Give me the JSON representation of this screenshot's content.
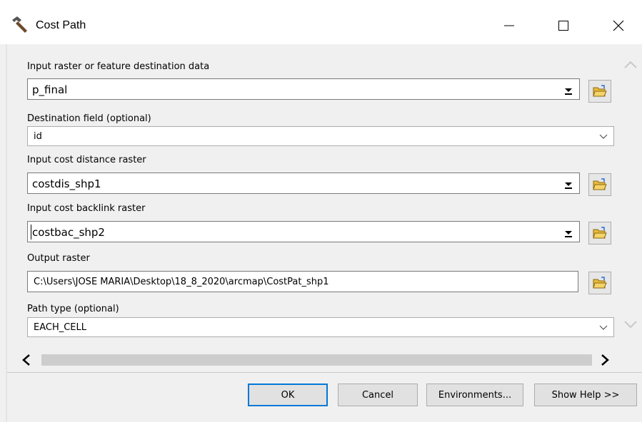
{
  "window": {
    "title": "Cost Path",
    "icon": "hammer-icon"
  },
  "params": {
    "input_dest": {
      "label": "Input raster or feature destination data",
      "value": "p_final"
    },
    "dest_field": {
      "label": "Destination field (optional)",
      "value": "id"
    },
    "cost_distance": {
      "label": "Input cost distance raster",
      "value": "costdis_shp1"
    },
    "cost_backlink": {
      "label": "Input cost backlink raster",
      "value": "costbac_shp2"
    },
    "output_raster": {
      "label": "Output raster",
      "value": "C:\\Users\\JOSE MARIA\\Desktop\\18_8_2020\\arcmap\\CostPat_shp1"
    },
    "path_type": {
      "label": "Path type (optional)",
      "value": "EACH_CELL"
    }
  },
  "buttons": {
    "ok": "OK",
    "cancel": "Cancel",
    "environments": "Environments...",
    "show_help": "Show Help >>"
  },
  "colors": {
    "primary_button_border": "#0078d7",
    "dialog_background": "#f0f0f0",
    "folder_icon": "#e8b93a"
  }
}
